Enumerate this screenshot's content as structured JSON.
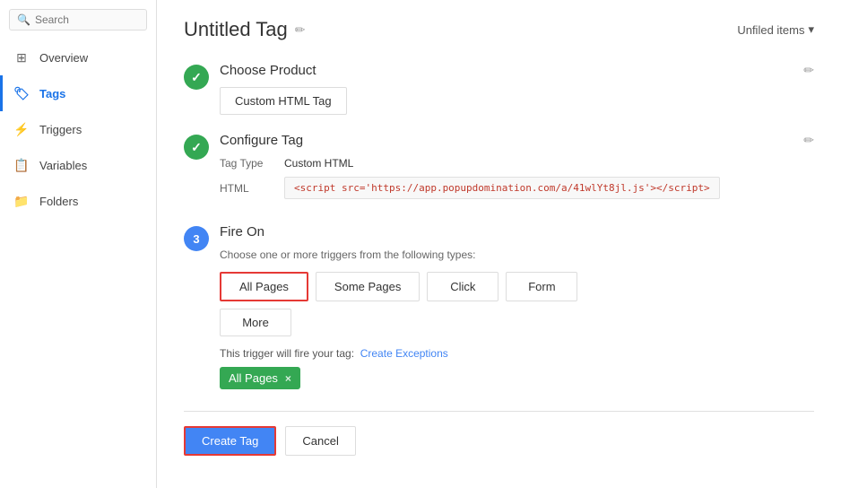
{
  "sidebar": {
    "search": {
      "placeholder": "Search"
    },
    "items": [
      {
        "id": "overview",
        "label": "Overview",
        "icon": "⊞",
        "active": false
      },
      {
        "id": "tags",
        "label": "Tags",
        "icon": "🏷",
        "active": true
      },
      {
        "id": "triggers",
        "label": "Triggers",
        "icon": "⚡",
        "active": false
      },
      {
        "id": "variables",
        "label": "Variables",
        "icon": "📁",
        "active": false
      },
      {
        "id": "folders",
        "label": "Folders",
        "icon": "📂",
        "active": false
      }
    ]
  },
  "header": {
    "title": "Untitled Tag",
    "unfiled_label": "Unfiled items",
    "unfiled_chevron": "▾"
  },
  "choose_product": {
    "section_title": "Choose Product",
    "button_label": "Custom HTML Tag"
  },
  "configure_tag": {
    "section_title": "Configure Tag",
    "tag_type_label": "Tag Type",
    "tag_type_value": "Custom HTML",
    "html_label": "HTML",
    "html_code": "<script src='https://app.popupdomination.com/a/41wlYt8jl.js'></script>"
  },
  "fire_on": {
    "section_title": "Fire On",
    "step_number": "3",
    "description": "Choose one or more triggers from the following types:",
    "trigger_buttons": [
      {
        "id": "all-pages",
        "label": "All Pages",
        "selected": true
      },
      {
        "id": "some-pages",
        "label": "Some Pages",
        "selected": false
      },
      {
        "id": "click",
        "label": "Click",
        "selected": false
      },
      {
        "id": "form",
        "label": "Form",
        "selected": false
      }
    ],
    "more_button": "More",
    "fire_label": "This trigger will fire your tag:",
    "create_exceptions_label": "Create Exceptions",
    "active_tag_label": "All Pages",
    "close_icon": "×"
  },
  "actions": {
    "create_label": "Create Tag",
    "cancel_label": "Cancel"
  }
}
